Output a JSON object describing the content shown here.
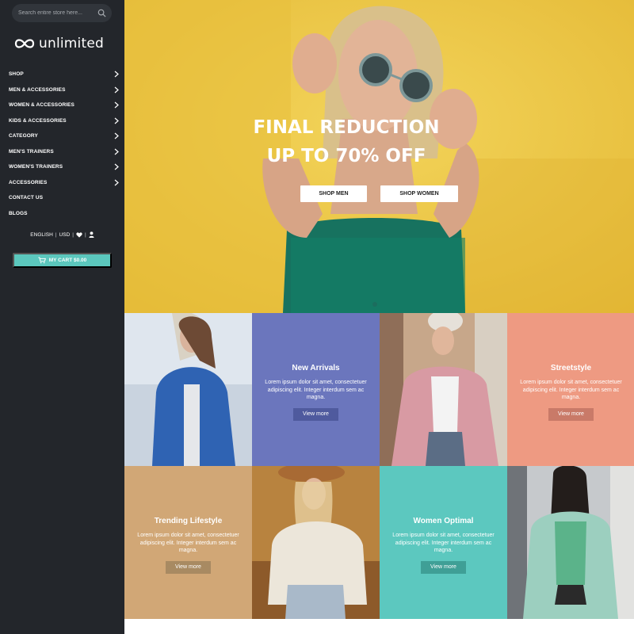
{
  "search": {
    "placeholder": "Search entire store here..."
  },
  "logo": {
    "text": "unlimited"
  },
  "nav": [
    {
      "label": "SHOP",
      "has_arrow": true
    },
    {
      "label": "MEN & ACCESSORIES",
      "has_arrow": true
    },
    {
      "label": "WOMEN & ACCESSORIES",
      "has_arrow": true
    },
    {
      "label": "KIDS & ACCESSORIES",
      "has_arrow": true
    },
    {
      "label": "CATEGORY",
      "has_arrow": true
    },
    {
      "label": "MEN'S TRAINERS",
      "has_arrow": true
    },
    {
      "label": "WOMEN'S TRAINERS",
      "has_arrow": true
    },
    {
      "label": "ACCESSORIES",
      "has_arrow": true
    },
    {
      "label": "CONTACT US",
      "has_arrow": false
    },
    {
      "label": "BLOGS",
      "has_arrow": false
    }
  ],
  "utils": {
    "language": "ENGLISH",
    "currency": "USD",
    "wishlist_icon": "heart-icon",
    "account_icon": "user-icon"
  },
  "cart": {
    "label": "MY CART $0.00",
    "icon": "cart-icon",
    "color": "#5bc7bd"
  },
  "hero": {
    "title_line1": "FINAL REDUCTION",
    "title_line2": "UP TO 70% OFF",
    "btn_men": "SHOP MEN",
    "btn_women": "SHOP WOMEN",
    "background_color": "#efc945"
  },
  "tiles": [
    {
      "title": "New Arrivals",
      "text": "Lorem ipsum dolor sit amet, consectetuer adipiscing elit. Integer interdum sem ac magna.",
      "button": "View more",
      "color": "#6b76bd",
      "button_color": "#4f5a9e"
    },
    {
      "title": "Streetstyle",
      "text": "Lorem ipsum dolor sit amet, consectetuer adipiscing elit. Integer interdum sem ac magna.",
      "button": "View more",
      "color": "#ee9a82",
      "button_color": "#c97a68"
    },
    {
      "title": "Trending Lifestyle",
      "text": "Lorem ipsum dolor sit amet, consectetuer adipiscing elit. Integer interdum sem ac magna.",
      "button": "View more",
      "color": "#d1a776",
      "button_color": "#a88a62"
    },
    {
      "title": "Women Optimal",
      "text": "Lorem ipsum dolor sit amet, consectetuer adipiscing elit. Integer interdum sem ac magna.",
      "button": "View more",
      "color": "#5cc8bf",
      "button_color": "#3f9f96"
    }
  ]
}
